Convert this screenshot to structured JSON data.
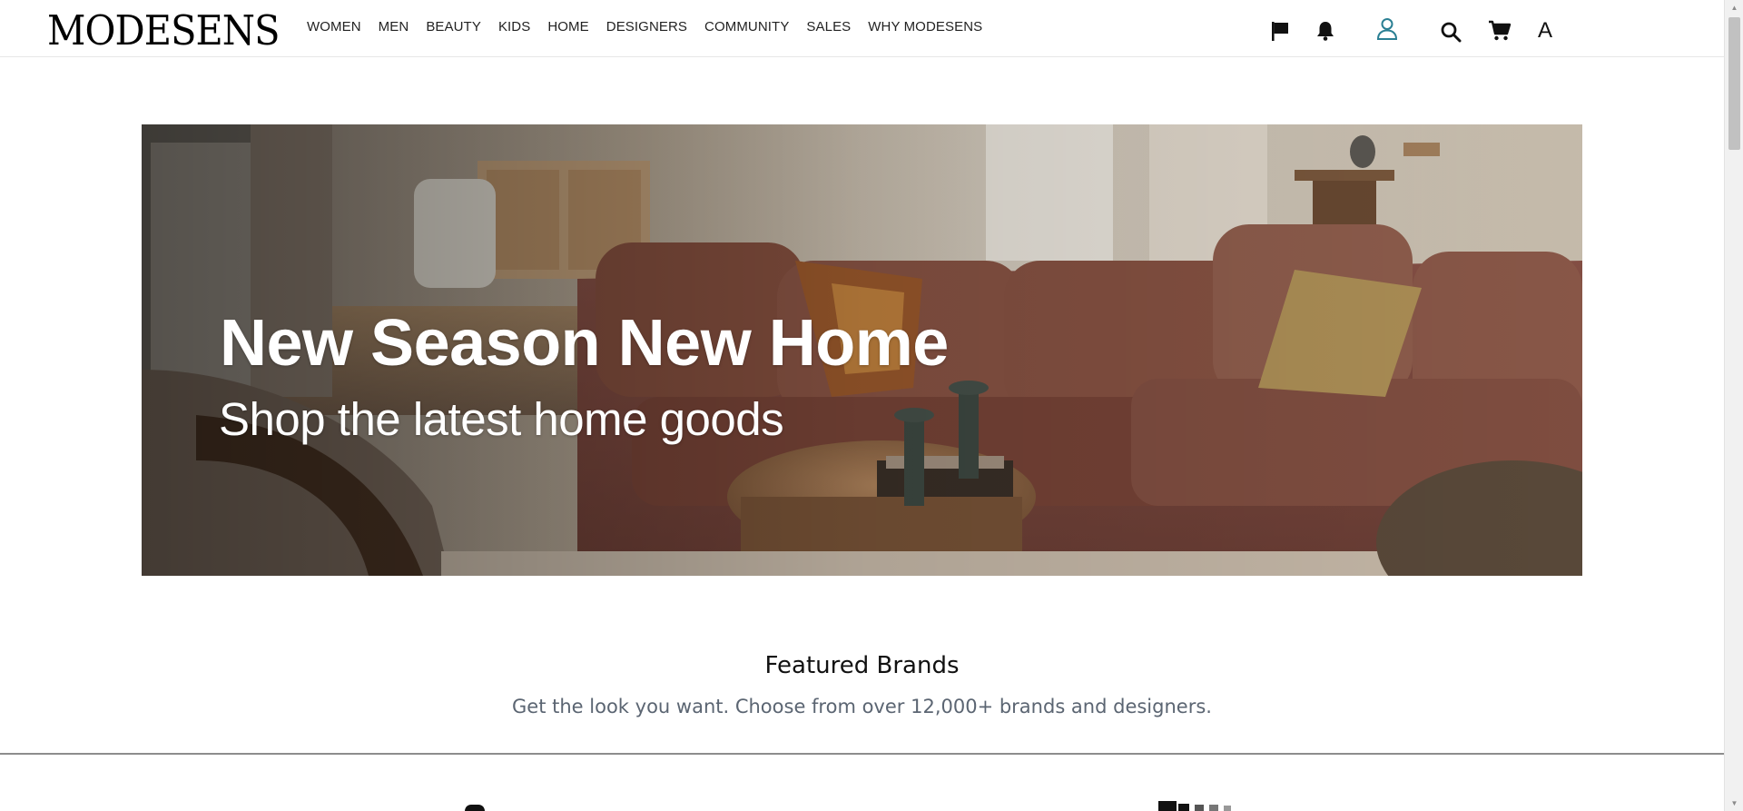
{
  "header": {
    "logo": "MODESENS",
    "nav": [
      "WOMEN",
      "MEN",
      "BEAUTY",
      "KIDS",
      "HOME",
      "DESIGNERS",
      "COMMUNITY",
      "SALES",
      "WHY MODESENS"
    ],
    "icons": {
      "flag": "flag-icon",
      "bell": "bell-icon",
      "user": "user-icon",
      "search": "search-icon",
      "cart": "cart-icon",
      "lang": "A"
    },
    "colors": {
      "user_icon": "#2a7f93",
      "text": "#111111"
    }
  },
  "hero": {
    "title": "New Season New Home",
    "subtitle": "Shop the latest home goods"
  },
  "featured": {
    "title": "Featured Brands",
    "subtitle": "Get the look you want. Choose from over 12,000+ brands and designers."
  }
}
